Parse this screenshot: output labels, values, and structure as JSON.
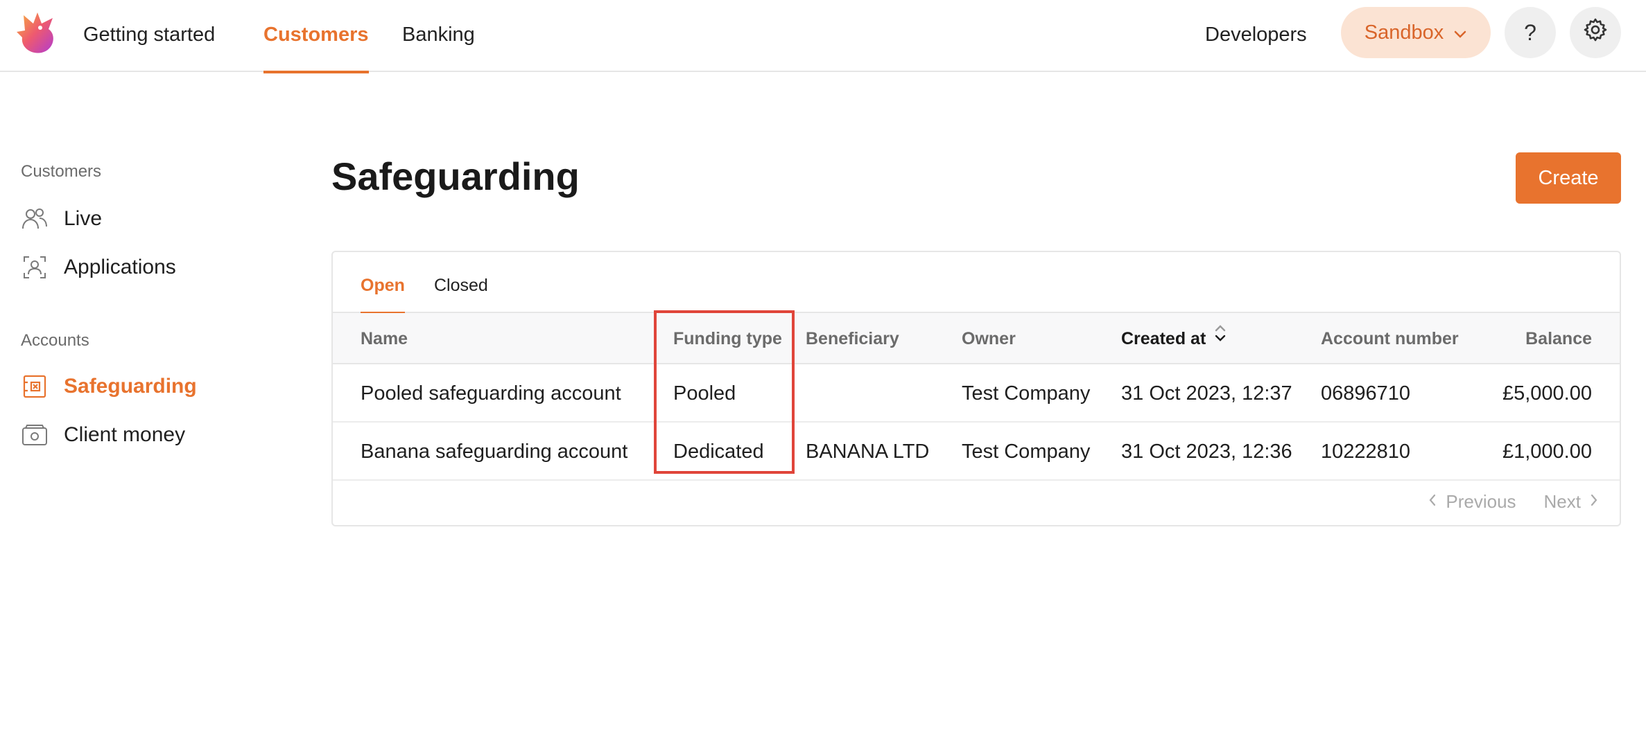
{
  "topnav": {
    "items": [
      {
        "label": "Getting started",
        "active": false
      },
      {
        "label": "Customers",
        "active": true
      },
      {
        "label": "Banking",
        "active": false
      }
    ],
    "developers_label": "Developers",
    "environment_label": "Sandbox",
    "help_label": "?",
    "accent_color": "#e8732e"
  },
  "sidebar": {
    "sections": [
      {
        "title": "Customers",
        "items": [
          {
            "label": "Live",
            "icon": "users-icon"
          },
          {
            "label": "Applications",
            "icon": "applicant-icon"
          }
        ]
      },
      {
        "title": "Accounts",
        "items": [
          {
            "label": "Safeguarding",
            "icon": "safeguarding-icon",
            "active": true
          },
          {
            "label": "Client money",
            "icon": "wallet-icon"
          }
        ]
      }
    ]
  },
  "main": {
    "title": "Safeguarding",
    "create_label": "Create",
    "tabs": [
      {
        "label": "Open",
        "active": true
      },
      {
        "label": "Closed",
        "active": false
      }
    ],
    "columns": [
      "Name",
      "Funding type",
      "Beneficiary",
      "Owner",
      "Created at",
      "Account number",
      "Balance"
    ],
    "rows": [
      {
        "name": "Pooled safeguarding account",
        "funding_type": "Pooled",
        "beneficiary": "",
        "owner": "Test Company",
        "created_at": "31 Oct 2023, 12:37",
        "account_number": "06896710",
        "balance": "£5,000.00"
      },
      {
        "name": "Banana safeguarding account",
        "funding_type": "Dedicated",
        "beneficiary": "BANANA LTD",
        "owner": "Test Company",
        "created_at": "31 Oct 2023, 12:36",
        "account_number": "10222810",
        "balance": "£1,000.00"
      }
    ],
    "pagination": {
      "previous": "Previous",
      "next": "Next"
    },
    "highlight_color": "#e0453a"
  }
}
